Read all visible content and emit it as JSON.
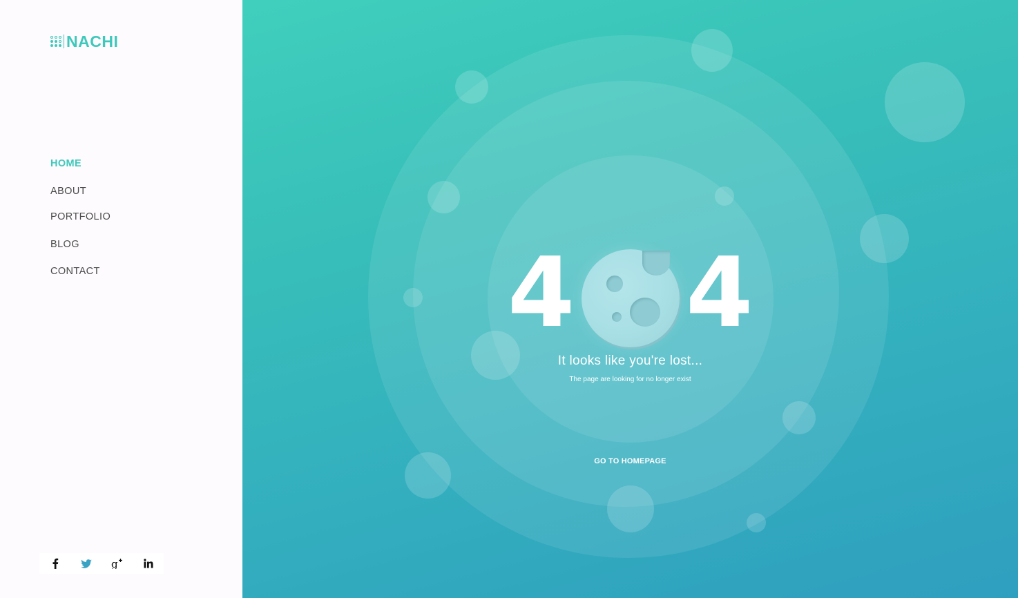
{
  "brand": {
    "name": "NACHI",
    "color": "#3ec8bc",
    "icon": "dots-grid-icon"
  },
  "nav": {
    "items": [
      {
        "label": "HOME",
        "active": true
      },
      {
        "label": "ABOUT",
        "active": false
      },
      {
        "label": "PORTFOLIO",
        "active": false
      },
      {
        "label": "BLOG",
        "active": false
      },
      {
        "label": "CONTACT",
        "active": false
      }
    ]
  },
  "social": [
    {
      "name": "facebook-icon",
      "color": "#111111"
    },
    {
      "name": "twitter-icon",
      "color": "#3aa3c4"
    },
    {
      "name": "google-plus-icon",
      "color": "#111111"
    },
    {
      "name": "linkedin-icon",
      "color": "#111111"
    }
  ],
  "error": {
    "digit_left": "4",
    "digit_right": "4",
    "moon_icon": "moon-icon",
    "headline": "It looks like you're lost...",
    "subtext": "The page are looking for no longer exist",
    "cta": "GO TO HOMEPAGE"
  },
  "colors": {
    "accent": "#3ec8bc",
    "gradient_top": "#40cfbd",
    "gradient_bottom": "#2f9fbf"
  }
}
